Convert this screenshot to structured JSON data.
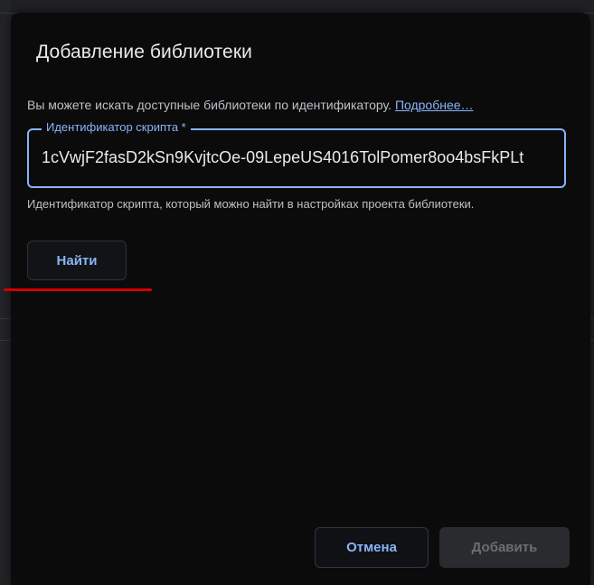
{
  "dialog": {
    "title": "Добавление библиотеки",
    "description": "Вы можете искать доступные библиотеки по идентификатору.",
    "learn_more_link": "Подробнее…",
    "script_id_field": {
      "label": "Идентификатор скрипта *",
      "value": "1cVwjF2fasD2kSn9KvjtcOe-09LepeUS4016TolPomer8oo4bsFkPLt"
    },
    "helper_text": "Идентификатор скрипта, который можно найти в настройках проекта библиотеки.",
    "find_button": "Найти",
    "cancel_button": "Отмена",
    "add_button": "Добавить"
  },
  "colors": {
    "accent": "#8ab4f8",
    "dialog_bg": "#0b0b0c",
    "annotation_underline": "#d50000"
  }
}
